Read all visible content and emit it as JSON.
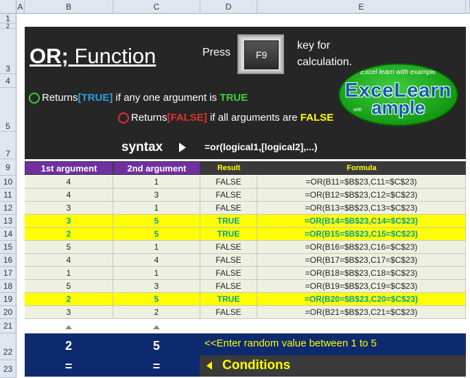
{
  "columns": [
    "A",
    "B",
    "C",
    "D",
    "E"
  ],
  "rows": [
    "1",
    "2",
    "3",
    "4",
    "5",
    "7",
    "9",
    "10",
    "11",
    "12",
    "13",
    "14",
    "15",
    "16",
    "17",
    "18",
    "19",
    "20",
    "21",
    "22",
    "23"
  ],
  "title": {
    "bold": "OR;",
    "rest": " Function"
  },
  "press_label": "Press",
  "f9_key": "F9",
  "key_for": [
    "key for",
    "calculation."
  ],
  "line1": {
    "prefix": "Returns ",
    "tag": "[TRUE]",
    "mid": " if any one argument is ",
    "word": "TRUE"
  },
  "line2": {
    "prefix": "Returns ",
    "tag": "[FALSE]",
    "mid": " if all arguments are ",
    "word": "FALSE"
  },
  "logo": {
    "top": "Excel learn with example",
    "line1": "ExceLearn",
    "line2": "ample",
    "small": "with"
  },
  "syntax_label": "syntax",
  "syntax_formula": "=or(logical1,[logical2],...)",
  "table": {
    "headers": [
      "1st  argument",
      "2nd  argument",
      "Result",
      "Formula"
    ],
    "rows": [
      {
        "a": "4",
        "b": "1",
        "r": "FALSE",
        "f": "=OR(B11=$B$23,C11=$C$23)",
        "hl": false
      },
      {
        "a": "4",
        "b": "3",
        "r": "FALSE",
        "f": "=OR(B12=$B$23,C12=$C$23)",
        "hl": false
      },
      {
        "a": "3",
        "b": "1",
        "r": "FALSE",
        "f": "=OR(B13=$B$23,C13=$C$23)",
        "hl": false
      },
      {
        "a": "3",
        "b": "5",
        "r": "TRUE",
        "f": "=OR(B14=$B$23,C14=$C$23)",
        "hl": true
      },
      {
        "a": "2",
        "b": "5",
        "r": "TRUE",
        "f": "=OR(B15=$B$23,C15=$C$23)",
        "hl": true
      },
      {
        "a": "5",
        "b": "1",
        "r": "FALSE",
        "f": "=OR(B16=$B$23,C16=$C$23)",
        "hl": false
      },
      {
        "a": "4",
        "b": "4",
        "r": "FALSE",
        "f": "=OR(B17=$B$23,C17=$C$23)",
        "hl": false
      },
      {
        "a": "1",
        "b": "1",
        "r": "FALSE",
        "f": "=OR(B18=$B$23,C18=$C$23)",
        "hl": false
      },
      {
        "a": "5",
        "b": "3",
        "r": "FALSE",
        "f": "=OR(B19=$B$23,C19=$C$23)",
        "hl": false
      },
      {
        "a": "2",
        "b": "5",
        "r": "TRUE",
        "f": "=OR(B20=$B$23,C20=$C$23)",
        "hl": true
      },
      {
        "a": "3",
        "b": "2",
        "r": "FALSE",
        "f": "=OR(B21=$B$23,C21=$C$23)",
        "hl": false
      }
    ]
  },
  "inputs": {
    "b": "2",
    "c": "5",
    "eq": "="
  },
  "enter_text": "<<Enter random value between 1 to 5",
  "conditions_label": "Conditions"
}
